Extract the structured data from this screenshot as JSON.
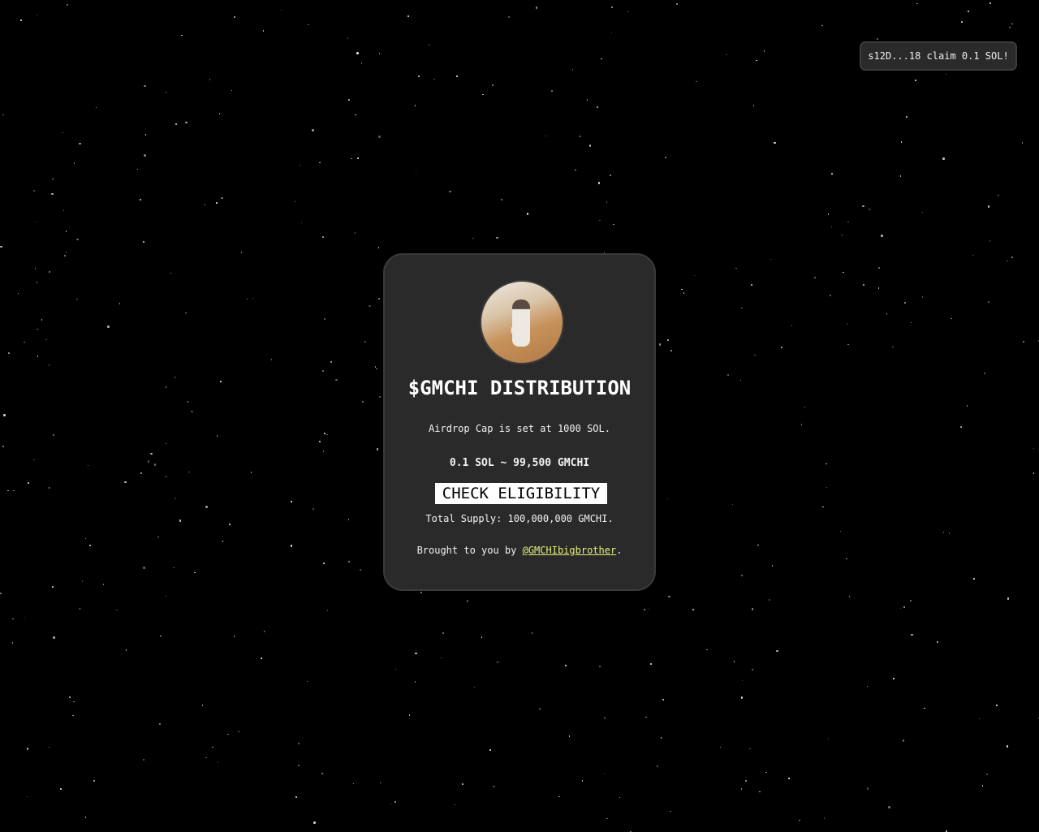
{
  "toast": {
    "text": "s12D...18 claim 0.1 SOL!"
  },
  "card": {
    "title": "$GMCHI DISTRIBUTION",
    "cap_text": "Airdrop Cap is set at 1000 SOL.",
    "rate_text": "0.1 SOL ~ 99,500 GMCHI",
    "button_label": "CHECK ELIGIBILITY",
    "supply_text": "Total Supply: 100,000,000 GMCHI.",
    "credit_prefix": "Brought to you by ",
    "credit_link": "@GMCHIbigbrother",
    "credit_suffix": "."
  },
  "colors": {
    "background": "#000000",
    "card": "#2a2a2a",
    "link": "#e6ee7a"
  }
}
